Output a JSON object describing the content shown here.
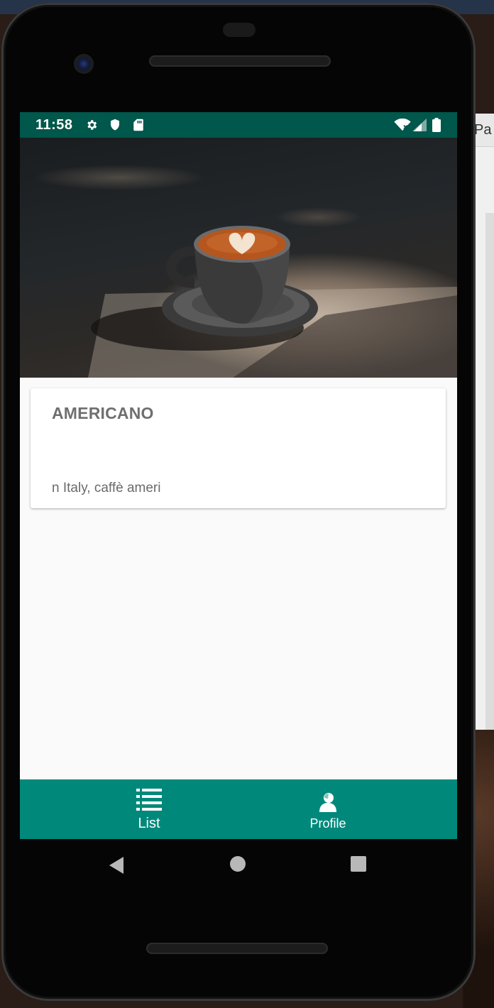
{
  "backdrop": {
    "window_fragment_text": "Pa"
  },
  "status_bar": {
    "time": "11:58",
    "left_icons": [
      "gear-icon",
      "shield-icon",
      "sd-card-icon"
    ],
    "right_icons": [
      "wifi-icon",
      "cellular-signal-icon",
      "battery-icon"
    ],
    "color": "#00574b"
  },
  "hero_image": {
    "subject": "cup of latte with heart latte art"
  },
  "card": {
    "title": "AMERICANO",
    "description": "n Italy, caffè ameri"
  },
  "bottom_nav": {
    "color": "#00897b",
    "items": [
      {
        "label": "List",
        "icon": "list-icon"
      },
      {
        "label": "Profile",
        "icon": "person-icon"
      }
    ]
  },
  "system_nav": [
    "back-icon",
    "home-icon",
    "recents-icon"
  ]
}
